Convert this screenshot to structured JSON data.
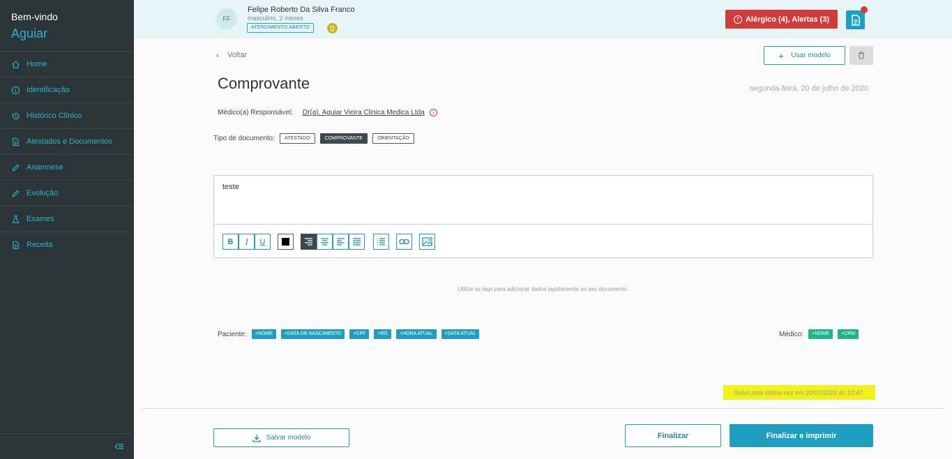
{
  "sidebar": {
    "welcome": "Bem-vindo",
    "user_name": "Aguiar",
    "items": [
      {
        "label": "Home",
        "icon": "home-icon"
      },
      {
        "label": "Identificação",
        "icon": "info-icon"
      },
      {
        "label": "Histórico Clínico",
        "icon": "history-icon"
      },
      {
        "label": "Atestados e Documentos",
        "icon": "document-icon"
      },
      {
        "label": "Anamnese",
        "icon": "pencil-icon"
      },
      {
        "label": "Evolução",
        "icon": "pencil-icon"
      },
      {
        "label": "Exames",
        "icon": "flask-icon"
      },
      {
        "label": "Receita",
        "icon": "document-icon"
      }
    ]
  },
  "header": {
    "avatar_initials": "FF",
    "patient_name": "Felipe Roberto Da Silva Franco",
    "patient_sub": "masculino, 2 meses",
    "status_badge": "ATENDIMENTO ABERTO",
    "alert_label": "Alérgico (4),  Alertas (3)"
  },
  "main": {
    "back_label": "Voltar",
    "use_model_label": "Usar modelo",
    "title": "Comprovante",
    "date": "segunda-feira, 20 de julho de 2020",
    "medico_label": "Médico(a) Responsável:",
    "medico_name": "Dr(a). Aguiar Vieira Clinica Medica Ltda",
    "tipo_label": "Tipo de documento:",
    "tipos": [
      "ATESTADO",
      "COMPROVANTE",
      "ORIENTAÇÃO"
    ],
    "tipo_selected": "COMPROVANTE",
    "editor_text": "teste",
    "tags_hint": "Utilize as tags para adicionar dados rapidamente ao seu documento.",
    "paciente_label": "Paciente:",
    "paciente_tags": [
      "+NOME",
      "+DATA DE NASCIMENTO",
      "+CPF",
      "+RG",
      "+HORA ATUAL",
      "+DATA ATUAL"
    ],
    "medico_tags_label": "Médico:",
    "medico_tags": [
      "+NOME",
      "+CRM"
    ],
    "saved_text": "Salvo pela última vez em 20/07/2020 às 10:47."
  },
  "footer": {
    "save_model_label": "Salvar modelo",
    "finalize_label": "Finalizar",
    "finalize_print_label": "Finalizar e imprimir"
  },
  "colors": {
    "sidebar_bg": "#2b3538",
    "accent": "#1f9fc0",
    "alert": "#d03c3c",
    "tag_green": "#1fb58c",
    "highlight": "#f2f21a"
  }
}
